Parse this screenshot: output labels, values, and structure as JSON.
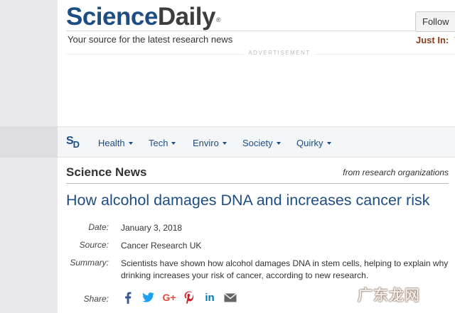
{
  "header": {
    "logo_part1": "Science",
    "logo_part2": "Daily",
    "logo_mark": "®",
    "tagline": "Your source for the latest research news",
    "follow_label": "Follow",
    "just_in_label": "Just In:",
    "just_in_partial": "T",
    "advertisement": "ADVERTISEMENT"
  },
  "nav": {
    "logo_s": "S",
    "logo_d": "D",
    "items": [
      {
        "label": "Health"
      },
      {
        "label": "Tech"
      },
      {
        "label": "Enviro"
      },
      {
        "label": "Society"
      },
      {
        "label": "Quirky"
      }
    ]
  },
  "article": {
    "section_title": "Science News",
    "from_text": "from research organizations",
    "headline": "How alcohol damages DNA and increases cancer risk",
    "date_label": "Date:",
    "date": "January 3, 2018",
    "source_label": "Source:",
    "source": "Cancer Research UK",
    "summary_label": "Summary:",
    "summary_line1": "Scientists have shown how alcohol damages DNA in stem cells, helping to explain why",
    "summary_line2": "drinking increases your risk of cancer, according to new research.",
    "share_label": "Share:",
    "share_icons": [
      "facebook-icon",
      "twitter-icon",
      "google-plus-icon",
      "pinterest-icon",
      "linkedin-icon",
      "email-icon"
    ]
  },
  "colors": {
    "brand_blue": "#1d4d82",
    "just_in": "#8a3c1a",
    "facebook": "#3b5998",
    "twitter": "#1da1f2",
    "google_plus": "#dd4b39",
    "pinterest": "#cb2027",
    "linkedin": "#0077b5",
    "email": "#666666"
  },
  "watermark": "广东龙网"
}
